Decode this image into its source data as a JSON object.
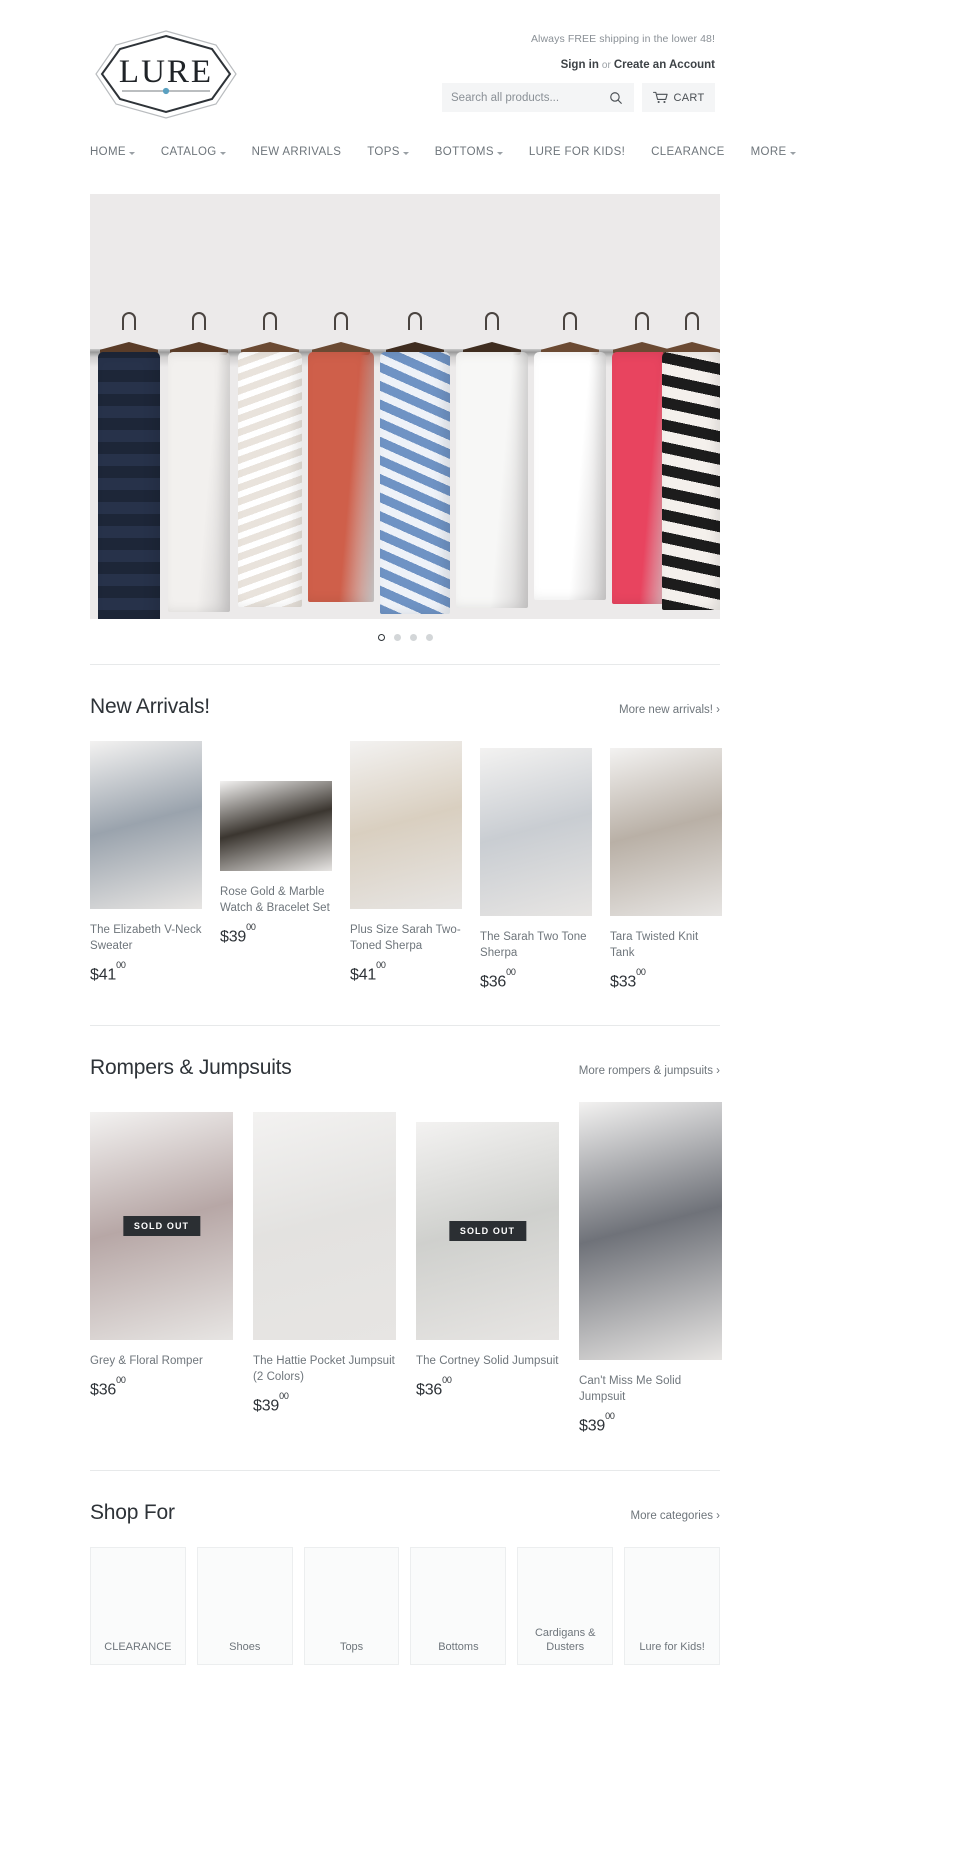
{
  "header": {
    "logo_text": "LURE",
    "shipping_message": "Always FREE shipping in the lower 48!",
    "sign_in_label": "Sign in",
    "or_label": "or",
    "create_account_label": "Create an Account",
    "search_placeholder": "Search all products...",
    "search_value": "",
    "search_icon": "search-icon",
    "cart_label": "CART",
    "cart_icon": "cart-icon"
  },
  "nav": {
    "items": [
      {
        "label": "HOME",
        "has_dropdown": true
      },
      {
        "label": "CATALOG",
        "has_dropdown": true
      },
      {
        "label": "NEW ARRIVALS",
        "has_dropdown": false
      },
      {
        "label": "TOPS",
        "has_dropdown": true
      },
      {
        "label": "BOTTOMS",
        "has_dropdown": true
      },
      {
        "label": "LURE FOR KIDS!",
        "has_dropdown": false
      },
      {
        "label": "CLEARANCE",
        "has_dropdown": false
      },
      {
        "label": "MORE",
        "has_dropdown": true
      }
    ]
  },
  "hero": {
    "alt": "clothing on wooden hangers on a rail",
    "slides_total": 4,
    "active_slide": 1
  },
  "sections": [
    {
      "title": "New Arrivals!",
      "more_label": "More new arrivals! ›",
      "products": [
        {
          "title": "The Elizabeth V-Neck Sweater",
          "price": "$41",
          "cents": "00",
          "sold_out": false
        },
        {
          "title": "Rose Gold & Marble Watch & Bracelet Set",
          "price": "$39",
          "cents": "00",
          "sold_out": false
        },
        {
          "title": "Plus Size Sarah Two-Toned Sherpa",
          "price": "$41",
          "cents": "00",
          "sold_out": false
        },
        {
          "title": "The Sarah Two Tone Sherpa",
          "price": "$36",
          "cents": "00",
          "sold_out": false
        },
        {
          "title": "Tara Twisted Knit Tank",
          "price": "$33",
          "cents": "00",
          "sold_out": false
        }
      ]
    },
    {
      "title": "Rompers & Jumpsuits",
      "more_label": "More rompers & jumpsuits ›",
      "products": [
        {
          "title": "Grey & Floral Romper",
          "price": "$36",
          "cents": "00",
          "sold_out": true,
          "sold_out_label": "SOLD OUT"
        },
        {
          "title": "The Hattie Pocket Jumpsuit (2 Colors)",
          "price": "$39",
          "cents": "00",
          "sold_out": false
        },
        {
          "title": "The Cortney Solid Jumpsuit",
          "price": "$36",
          "cents": "00",
          "sold_out": true,
          "sold_out_label": "SOLD OUT"
        },
        {
          "title": "Can't Miss Me Solid Jumpsuit",
          "price": "$39",
          "cents": "00",
          "sold_out": false
        }
      ]
    }
  ],
  "shop_for": {
    "title": "Shop For",
    "more_label": "More categories ›",
    "categories": [
      {
        "label": "CLEARANCE"
      },
      {
        "label": "Shoes"
      },
      {
        "label": "Tops"
      },
      {
        "label": "Bottoms"
      },
      {
        "label": "Cardigans & Dusters"
      },
      {
        "label": "Lure for Kids!"
      }
    ]
  },
  "colors": {
    "text_dark": "#2e3338",
    "text_muted": "#6e757b",
    "field_bg": "#f4f5f6",
    "logo_accent": "#5aa0c0"
  }
}
